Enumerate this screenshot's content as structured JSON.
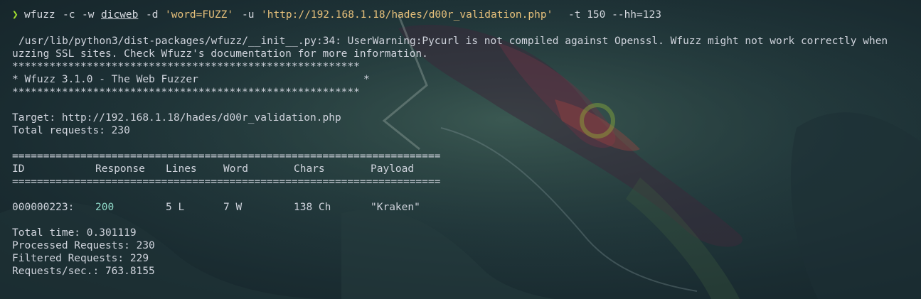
{
  "prompt_symbol": "❯",
  "command": {
    "program": "wfuzz",
    "flag_c": "-c",
    "flag_w": "-w",
    "wordlist": "dicweb",
    "flag_d": "-d",
    "post_data": "'word=FUZZ'",
    "flag_u": "-u",
    "url": "'http://192.168.1.18/hades/d00r_validation.php'",
    "tail": "-t 150 --hh=123"
  },
  "warning": {
    "line1": "/usr/lib/python3/dist-packages/wfuzz/__init__.py:34: UserWarning:Pycurl is not compiled against Openssl. Wfuzz might not work correctly when",
    "line2": "uzzing SSL sites. Check Wfuzz's documentation for more information."
  },
  "banner": {
    "border_top": "********************************************************",
    "title": "* Wfuzz 3.1.0 - The Web Fuzzer",
    "title_end": "*",
    "border_bottom": "********************************************************"
  },
  "target": {
    "target_line": "Target: http://192.168.1.18/hades/d00r_validation.php",
    "total_requests": "Total requests: 230"
  },
  "table": {
    "separator": "=====================================================================",
    "headers": [
      "ID",
      "Response",
      "Lines",
      "Word",
      "Chars",
      "Payload"
    ],
    "rows": [
      {
        "id": "000000223:",
        "response": "200",
        "lines": "5 L",
        "word": "7 W",
        "chars": "138 Ch",
        "payload": "\"Kraken\""
      }
    ]
  },
  "stats": {
    "total_time": "Total time: 0.301119",
    "processed": "Processed Requests: 230",
    "filtered": "Filtered Requests: 229",
    "rate": "Requests/sec.: 763.8155"
  },
  "colors": {
    "prompt": "#a6e22e",
    "string": "#e6c07b",
    "response_200": "#8fd9c8",
    "text": "#cfd3dc"
  }
}
